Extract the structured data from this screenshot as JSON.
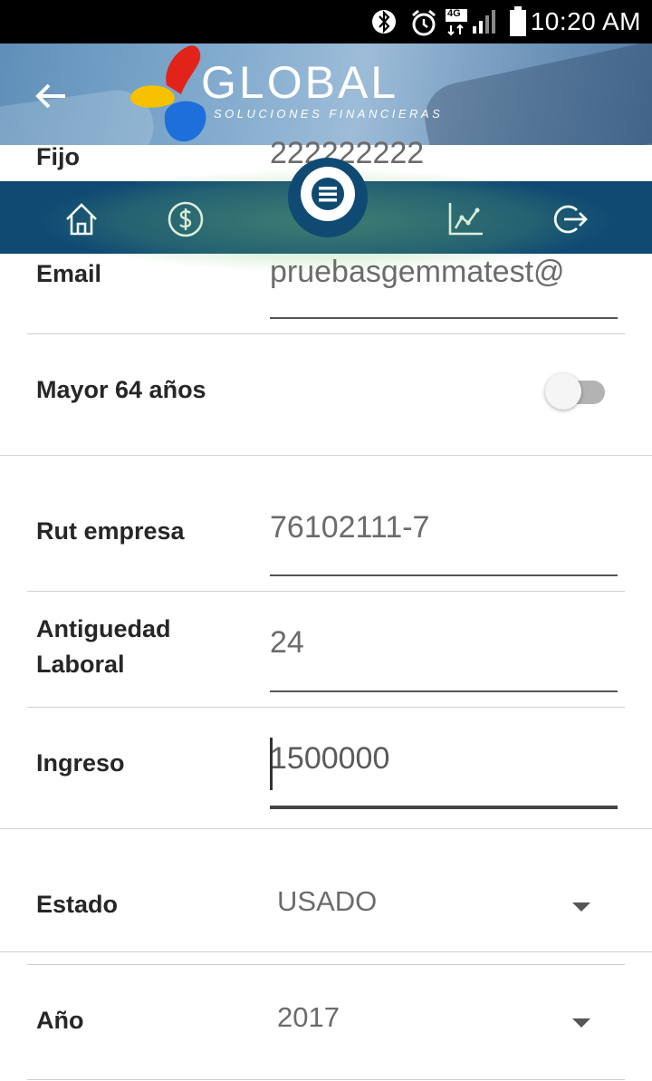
{
  "status_bar": {
    "time": "10:20 AM",
    "network_label": "4G",
    "icons": [
      "bluetooth-icon",
      "alarm-icon",
      "signal-icon",
      "battery-icon"
    ]
  },
  "header": {
    "logo_text": "GLOBAL",
    "logo_subtitle": "SOLUCIONES FINANCIERAS",
    "back_icon": "arrow-left-icon",
    "colors": {
      "banner": "#6f95ba",
      "logo_red": "#e2231a",
      "logo_yellow": "#f6c200",
      "logo_blue": "#1e6fd9"
    }
  },
  "nav": {
    "color": "#0f4a73",
    "items": [
      "home-icon",
      "dollar-icon",
      "menu-icon",
      "chart-icon",
      "logout-icon"
    ]
  },
  "form": {
    "fijo_label": "Fijo",
    "fijo_value": "222222222",
    "email_label": "Email",
    "email_value": "pruebasgemmatest@",
    "mayor_label": "Mayor 64 años",
    "mayor_enabled": false,
    "rut_label": "Rut empresa",
    "rut_value": "76102111-7",
    "antiguedad_label": "Antiguedad Laboral",
    "antiguedad_value": "24",
    "ingreso_label": "Ingreso",
    "ingreso_value": "1500000",
    "estado_label": "Estado",
    "estado_value": "USADO",
    "anio_label": "Año",
    "anio_value": "2017"
  }
}
